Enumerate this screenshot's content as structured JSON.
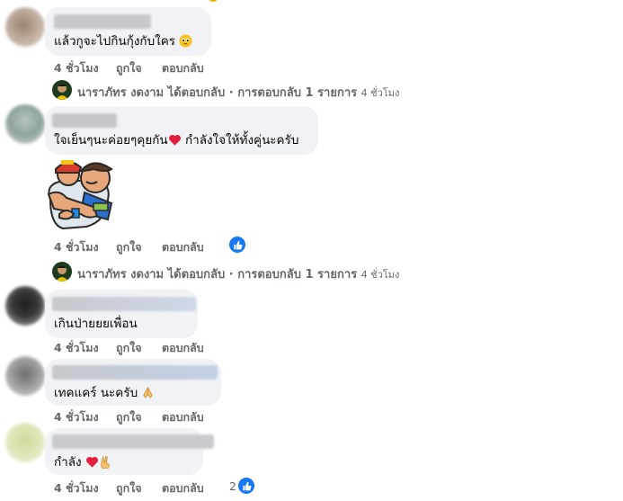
{
  "comments": [
    {
      "text": "แล้วกูจะไปกินกุ้งกับใคร",
      "emoji": "pleading-face",
      "time": "4 ชั่วโมง",
      "like": "ถูกใจ",
      "reply": "ตอบกลับ"
    },
    {
      "text": "ใจเย็นๆนะค่อยๆคุยกัน",
      "emoji": "red-heart",
      "text_after": "กำลังใจให้ทั้งคู่นะครับ",
      "sticker": "hug-sticker",
      "time": "4 ชั่วโมง",
      "like": "ถูกใจ",
      "reply": "ตอบกลับ",
      "reaction": "like"
    },
    {
      "text": "เกินป่ายยยเพื่อน",
      "time": "4 ชั่วโมง",
      "like": "ถูกใจ",
      "reply": "ตอบกลับ"
    },
    {
      "text": "เทคแคร์ นะครับ",
      "emoji": "folded-hands",
      "time": "4 ชั่วโมง",
      "like": "ถูกใจ",
      "reply": "ตอบกลับ"
    },
    {
      "text": "กำลัง",
      "emoji": "red-heart victory-hand",
      "time": "4 ชั่วโมง",
      "like": "ถูกใจ",
      "reply": "ตอบกลับ",
      "reaction_count": "2",
      "reaction": "like"
    }
  ],
  "replies": [
    {
      "text": "นาราภัทร งดงาม ได้ตอบกลับ · การตอบกลับ 1 รายการ",
      "time": "4 ชั่วโมง"
    },
    {
      "text": "นาราภัทร งดงาม ได้ตอบกลับ · การตอบกลับ 1 รายการ",
      "time": "4 ชั่วโมง"
    }
  ],
  "colors": {
    "bubble": "#f0f2f5",
    "meta": "#65676b",
    "like_blue": "#1877f2",
    "heart": "#e41e3f"
  }
}
